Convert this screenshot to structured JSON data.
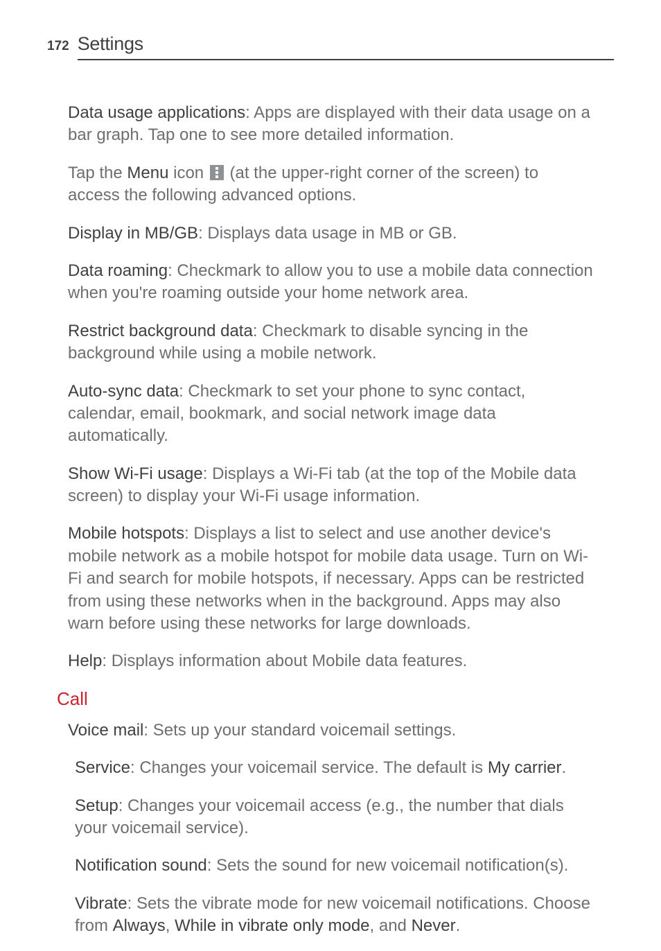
{
  "header": {
    "page_number": "172",
    "section_title": "Settings"
  },
  "paragraphs": {
    "p1_term": "Data usage applications",
    "p1_rest": ": Apps are displayed with their data usage on a bar graph. Tap one to see more detailed information.",
    "p2_a": "Tap the ",
    "p2_term": "Menu",
    "p2_b": " icon ",
    "p2_c": " (at the upper-right corner of the screen) to access the following advanced options.",
    "p3_term": "Display in MB/GB",
    "p3_rest": ": Displays data usage in MB or GB.",
    "p4_term": "Data roaming",
    "p4_rest": ": Checkmark to allow you to use a mobile data connection when you're roaming outside your home network area.",
    "p5_term": "Restrict background data",
    "p5_rest": ": Checkmark to disable syncing in the background while using a mobile network.",
    "p6_term": "Auto-sync data",
    "p6_rest": ": Checkmark to set your phone to sync contact, calendar, email, bookmark, and social network image data automatically.",
    "p7_term": "Show Wi-Fi usage",
    "p7_rest": ": Displays a Wi-Fi tab (at the top of the Mobile data screen) to display your Wi-Fi usage information.",
    "p8_term": "Mobile hotspots",
    "p8_rest": ": Displays a list to select and use another device's mobile network as a mobile hotspot for mobile data usage. Turn on Wi-Fi and search for mobile hotspots, if necessary. Apps can be restricted from using these networks when in the background. Apps may also warn before using these networks for large downloads.",
    "p9_term": "Help",
    "p9_rest": ": Displays information about Mobile data features."
  },
  "subsection": {
    "title": "Call"
  },
  "call_paragraphs": {
    "c1_term": "Voice mail",
    "c1_rest": ": Sets up your standard voicemail settings.",
    "c2_term": "Service",
    "c2_mid": ": Changes your voicemail service. The default is ",
    "c2_term2": "My carrier",
    "c2_end": ".",
    "c3_term": "Setup",
    "c3_rest": ": Changes your voicemail access (e.g., the number that dials your voicemail service).",
    "c4_term": "Notification sound",
    "c4_rest": ": Sets the sound for new voicemail notification(s).",
    "c5_term": "Vibrate",
    "c5_mid": ": Sets the vibrate mode for new voicemail notifications. Choose from ",
    "c5_opt1": "Always",
    "c5_sep1": ", ",
    "c5_opt2": "While in vibrate only mode",
    "c5_sep2": ", and ",
    "c5_opt3": "Never",
    "c5_end": "."
  }
}
